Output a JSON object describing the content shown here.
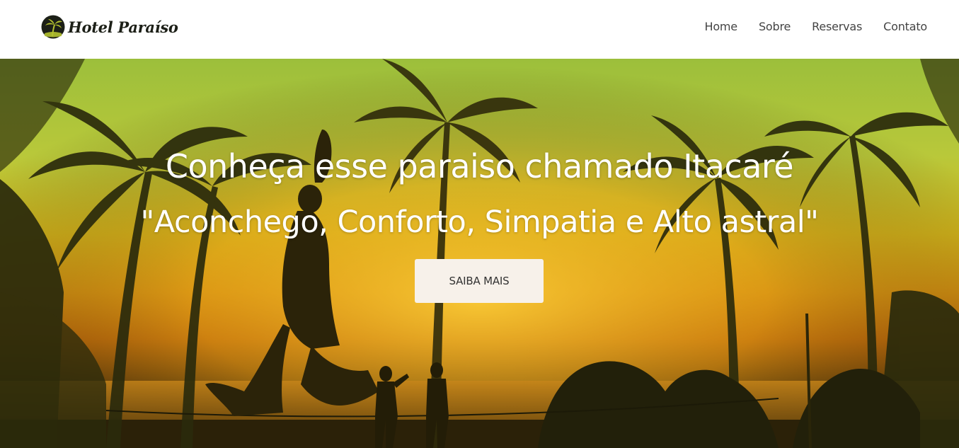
{
  "header": {
    "logo_text": "Hotel Paraíso",
    "logo_icon": "palm-tree-icon"
  },
  "nav": {
    "items": [
      {
        "label": "Home"
      },
      {
        "label": "Sobre"
      },
      {
        "label": "Reservas"
      },
      {
        "label": "Contato"
      }
    ]
  },
  "hero": {
    "title": "Conheça esse paraiso chamado Itacaré",
    "subtitle": "\"Aconchego, Conforto, Simpatia e Alto astral\"",
    "cta_label": "SAIBA MAIS",
    "background_image": "sunset-beach-palm-trees-slackline-photo"
  },
  "colors": {
    "header_bg": "#ffffff",
    "nav_text": "#444444",
    "hero_text": "#ffffff",
    "cta_bg": "#f7f1ea",
    "cta_text": "#333333",
    "logo_text": "#1c1f17"
  }
}
